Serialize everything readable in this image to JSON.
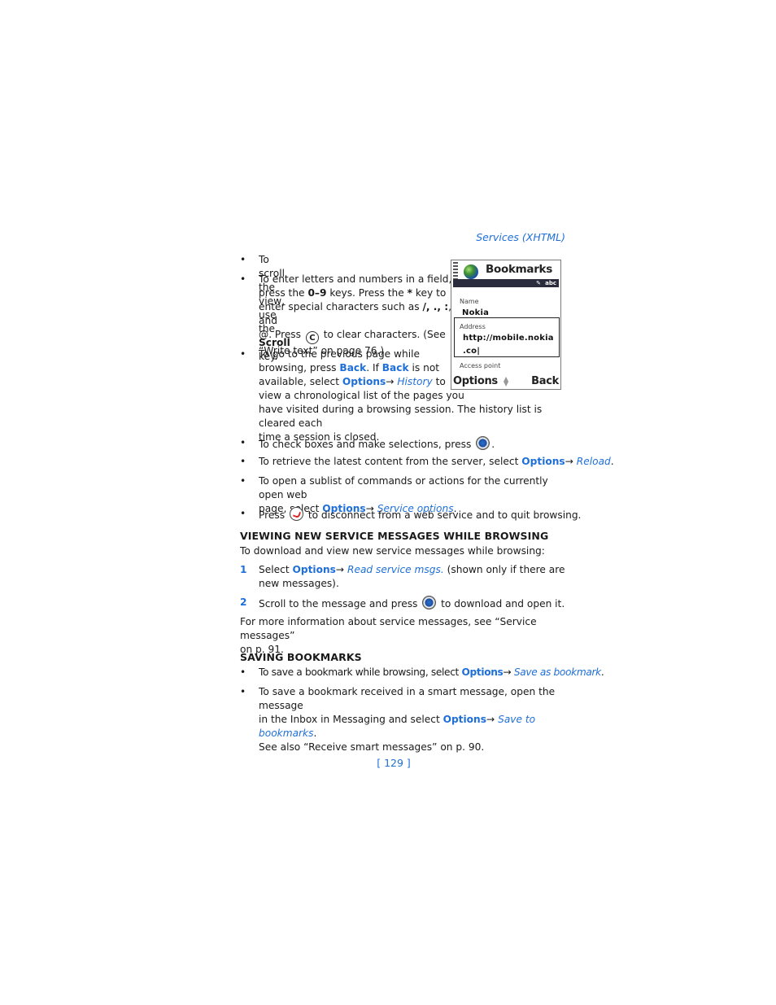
{
  "header": "Services (XHTML)",
  "bullets_top": [
    {
      "pre": "To scroll the view, use the ",
      "bold": "Scroll",
      "post": " key."
    }
  ],
  "enter_letters": {
    "l1": "To enter letters and numbers in a field,",
    "l2_pre": "press the ",
    "l2_bold1": "0–9",
    "l2_mid": " keys. Press the ",
    "l2_bold2": "*",
    "l2_post": " key to",
    "l3_pre": "enter special characters such as ",
    "l3_bold": "/, ., :",
    "l3_post": ", and",
    "l4_pre": "@. Press ",
    "l4_key": "C",
    "l4_post": " to clear characters. (See",
    "l5": "“Write text” on page 76.)"
  },
  "prev_page": {
    "l1": "To go to the previous page while",
    "l2_pre": "browsing, press ",
    "back1": "Back",
    "l2_mid": ". If ",
    "back2": "Back",
    "l2_post": " is not",
    "l3_pre": "available, select ",
    "options": "Options",
    "arrow": "→ ",
    "history": "History",
    "l3_post": " to",
    "l4": "view a chronological list of the pages you",
    "l5": "have visited during a browsing session. The history list is cleared each",
    "l6": "time a session is closed."
  },
  "check_boxes": {
    "pre": "To check boxes and make selections, press ",
    "post": "."
  },
  "retrieve": {
    "pre": "To retrieve the latest content from the server, select ",
    "options": "Options",
    "arrow": "→ ",
    "item": "Reload",
    "post": "."
  },
  "sublist": {
    "l1": "To open a sublist of commands or actions for the currently open web",
    "l2_pre": "page, select ",
    "options": "Options",
    "arrow": "→ ",
    "item": "Service options",
    "post": "."
  },
  "disconnect": {
    "pre": "Press ",
    "post": " to disconnect from a web service and to quit browsing."
  },
  "heading1": "VIEWING NEW SERVICE MESSAGES WHILE BROWSING",
  "para1": "To download and view new service messages while browsing:",
  "step1": {
    "num": "1",
    "l1_pre": "Select ",
    "options": "Options",
    "arrow": "→ ",
    "item": "Read service msgs.",
    "l1_post": " (shown only if there are",
    "l2": "new messages)."
  },
  "step2": {
    "num": "2",
    "pre": "Scroll to the message and press ",
    "post": " to download and open it."
  },
  "para2": {
    "l1": "For more information about service messages, see “Service messages”",
    "l2": "on p. 91."
  },
  "heading2": "SAVING BOOKMARKS",
  "save1": {
    "pre": "To save a bookmark while browsing, select ",
    "options": "Options",
    "arrow": "→ ",
    "item": "Save as bookmark",
    "post": "."
  },
  "save2": {
    "l1": "To save a bookmark received in a smart message, open the message",
    "l2_pre": "in the Inbox in Messaging and select ",
    "options": "Options",
    "arrow": "→ ",
    "item": "Save to bookmarks",
    "l2_post": ".",
    "l3": "See also “Receive smart messages” on p. 90."
  },
  "bullet_char": "•",
  "page_number": "[ 129 ]",
  "phone": {
    "title": "Bookmarks",
    "mode": "abc",
    "name_label": "Name",
    "name_value": "Nokia",
    "address_label": "Address",
    "address_line1": "http://mobile.nokia",
    "address_line2": ".co|",
    "access_label": "Access point",
    "left_soft": "Options",
    "right_soft": "Back"
  }
}
